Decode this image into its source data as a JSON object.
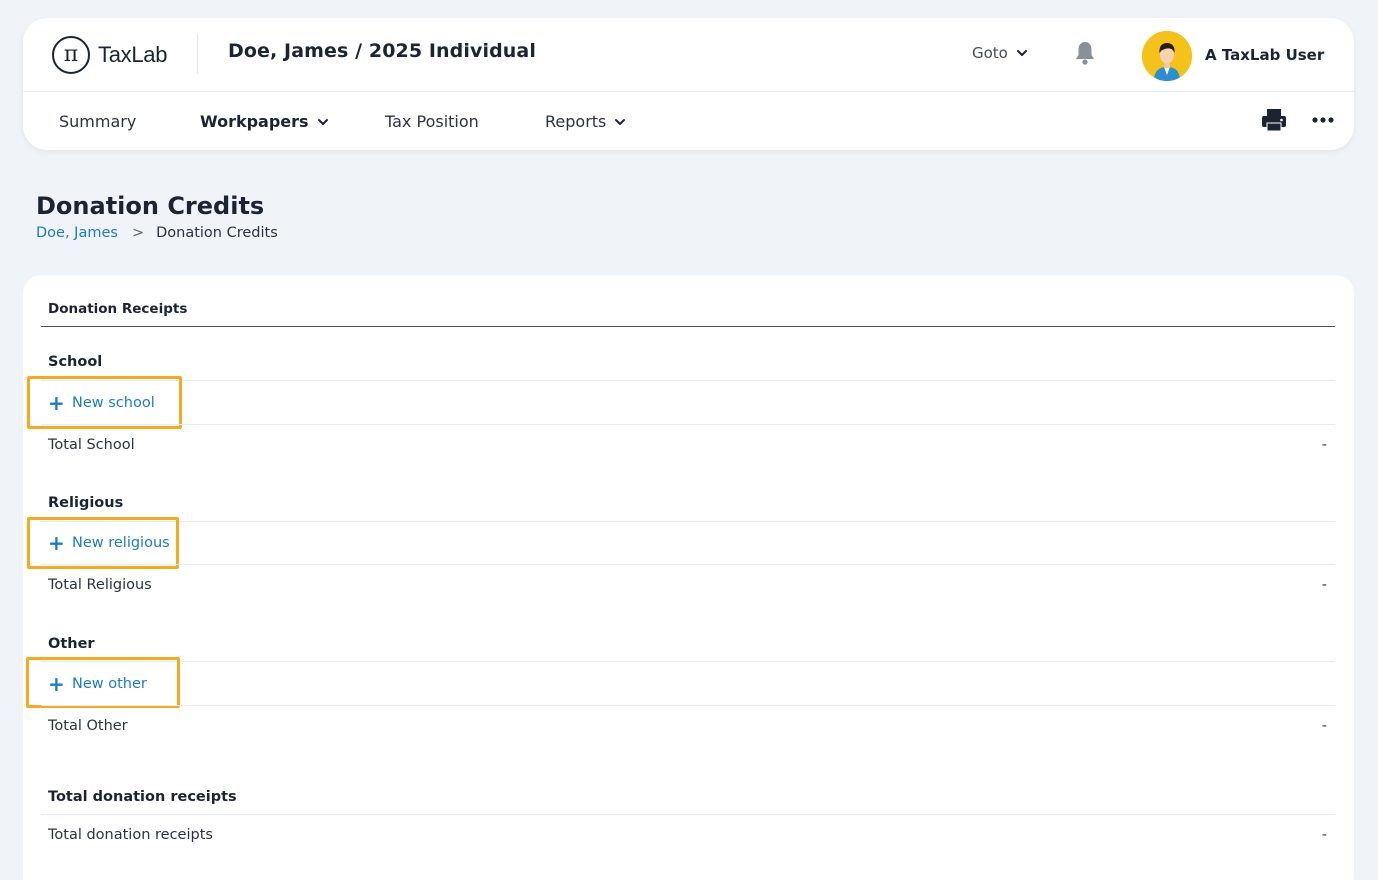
{
  "header": {
    "logo_mark": "π",
    "logo_text": "TaxLab",
    "client_title": "Doe, James / 2025 Individual",
    "goto_label": "Goto",
    "user_name": "A TaxLab User"
  },
  "nav": {
    "summary": "Summary",
    "workpapers": "Workpapers",
    "tax_position": "Tax Position",
    "reports": "Reports"
  },
  "page": {
    "title": "Donation Credits",
    "breadcrumb": {
      "parent": "Doe, James",
      "separator": ">",
      "current": "Donation Credits"
    }
  },
  "receipts": {
    "section_title": "Donation Receipts",
    "groups": [
      {
        "title": "School",
        "new_label": "New school",
        "total_label": "Total School",
        "total_value": "-"
      },
      {
        "title": "Religious",
        "new_label": "New religious",
        "total_label": "Total Religious",
        "total_value": "-"
      },
      {
        "title": "Other",
        "new_label": "New other",
        "total_label": "Total Other",
        "total_value": "-"
      }
    ],
    "grand_total": {
      "title": "Total donation receipts",
      "label": "Total donation receipts",
      "value": "-"
    }
  },
  "colors": {
    "accent_link": "#1b7bc4",
    "highlight": "#f8a91d",
    "avatar_bg": "#f4c218",
    "page_bg": "#f0f3f7"
  }
}
